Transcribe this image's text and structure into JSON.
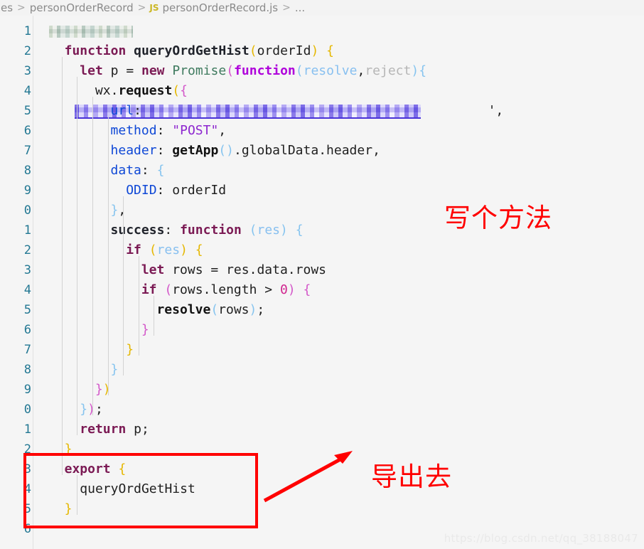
{
  "breadcrumb": {
    "items": [
      {
        "label": "es",
        "icon": null
      },
      {
        "label": "personOrderRecord",
        "icon": null
      },
      {
        "label": "personOrderRecord.js",
        "icon": "js-file-icon",
        "badge": "JS"
      },
      {
        "label": "...",
        "icon": null
      }
    ],
    "separator": ">",
    "js_badge": "JS",
    "ellipsis": "..."
  },
  "editor": {
    "language": "javascript",
    "theme": "light",
    "line_numbers": [
      "1",
      "2",
      "3",
      "4",
      "5",
      "6",
      "7",
      "8",
      "9",
      "0",
      "1",
      "2",
      "3",
      "4",
      "5",
      "6",
      "7",
      "8",
      "9",
      "0",
      "1",
      "2",
      "3",
      "4",
      "5",
      "6"
    ],
    "lines": [
      {
        "n": "1",
        "tokens": [
          {
            "t": "redacted-comment",
            "v": ""
          }
        ]
      },
      {
        "n": "2",
        "tokens": [
          {
            "t": "kw",
            "v": "function"
          },
          {
            "t": "sp",
            "v": " "
          },
          {
            "t": "fname",
            "v": "queryOrdGetHist"
          },
          {
            "t": "b-y",
            "v": "("
          },
          {
            "t": "propd",
            "v": "orderId"
          },
          {
            "t": "b-y",
            "v": ")"
          },
          {
            "t": "sp",
            "v": " "
          },
          {
            "t": "b-y",
            "v": "{"
          }
        ]
      },
      {
        "n": "3",
        "tokens": [
          {
            "t": "kw",
            "v": "let"
          },
          {
            "t": "sp",
            "v": " "
          },
          {
            "t": "propd",
            "v": "p"
          },
          {
            "t": "sp",
            "v": " "
          },
          {
            "t": "punct",
            "v": "="
          },
          {
            "t": "sp",
            "v": " "
          },
          {
            "t": "kw",
            "v": "new"
          },
          {
            "t": "sp",
            "v": " "
          },
          {
            "t": "cls",
            "v": "Promise"
          },
          {
            "t": "b-m",
            "v": "("
          },
          {
            "t": "kwfn",
            "v": "function"
          },
          {
            "t": "b-b",
            "v": "("
          },
          {
            "t": "param",
            "v": "resolve"
          },
          {
            "t": "punct",
            "v": ","
          },
          {
            "t": "unused",
            "v": "reject"
          },
          {
            "t": "b-b",
            "v": ")"
          },
          {
            "t": "b-b",
            "v": "{"
          }
        ]
      },
      {
        "n": "4",
        "tokens": [
          {
            "t": "propd",
            "v": "wx"
          },
          {
            "t": "punct",
            "v": "."
          },
          {
            "t": "call",
            "v": "request"
          },
          {
            "t": "b-y",
            "v": "("
          },
          {
            "t": "b-m",
            "v": "{"
          }
        ]
      },
      {
        "n": "5",
        "tokens": [
          {
            "t": "prop",
            "v": "url"
          },
          {
            "t": "punct",
            "v": ":"
          },
          {
            "t": "redacted-url",
            "v": ""
          },
          {
            "t": "punct",
            "v": "',"
          }
        ]
      },
      {
        "n": "6",
        "tokens": [
          {
            "t": "prop",
            "v": "method"
          },
          {
            "t": "punct",
            "v": ":"
          },
          {
            "t": "sp",
            "v": " "
          },
          {
            "t": "str",
            "v": "\"POST\""
          },
          {
            "t": "punct",
            "v": ","
          }
        ]
      },
      {
        "n": "7",
        "tokens": [
          {
            "t": "prop",
            "v": "header"
          },
          {
            "t": "punct",
            "v": ":"
          },
          {
            "t": "sp",
            "v": " "
          },
          {
            "t": "call",
            "v": "getApp"
          },
          {
            "t": "b-b",
            "v": "()"
          },
          {
            "t": "punct",
            "v": "."
          },
          {
            "t": "propd",
            "v": "globalData"
          },
          {
            "t": "punct",
            "v": "."
          },
          {
            "t": "propd",
            "v": "header"
          },
          {
            "t": "punct",
            "v": ","
          }
        ]
      },
      {
        "n": "8",
        "tokens": [
          {
            "t": "prop",
            "v": "data"
          },
          {
            "t": "punct",
            "v": ":"
          },
          {
            "t": "sp",
            "v": " "
          },
          {
            "t": "b-b",
            "v": "{"
          }
        ]
      },
      {
        "n": "9",
        "tokens": [
          {
            "t": "prop",
            "v": "ODID"
          },
          {
            "t": "punct",
            "v": ":"
          },
          {
            "t": "sp",
            "v": " "
          },
          {
            "t": "propd",
            "v": "orderId"
          }
        ]
      },
      {
        "n": "0",
        "tokens": [
          {
            "t": "b-b",
            "v": "}"
          },
          {
            "t": "punct",
            "v": ","
          }
        ]
      },
      {
        "n": "1",
        "tokens": [
          {
            "t": "fname",
            "v": "success"
          },
          {
            "t": "punct",
            "v": ":"
          },
          {
            "t": "sp",
            "v": " "
          },
          {
            "t": "kw",
            "v": "function"
          },
          {
            "t": "sp",
            "v": " "
          },
          {
            "t": "b-b",
            "v": "("
          },
          {
            "t": "param",
            "v": "res"
          },
          {
            "t": "b-b",
            "v": ")"
          },
          {
            "t": "sp",
            "v": " "
          },
          {
            "t": "b-b",
            "v": "{"
          }
        ]
      },
      {
        "n": "2",
        "tokens": [
          {
            "t": "kw",
            "v": "if"
          },
          {
            "t": "sp",
            "v": " "
          },
          {
            "t": "b-y",
            "v": "("
          },
          {
            "t": "param",
            "v": "res"
          },
          {
            "t": "b-y",
            "v": ")"
          },
          {
            "t": "sp",
            "v": " "
          },
          {
            "t": "b-y",
            "v": "{"
          }
        ]
      },
      {
        "n": "3",
        "tokens": [
          {
            "t": "kw",
            "v": "let"
          },
          {
            "t": "sp",
            "v": " "
          },
          {
            "t": "propd",
            "v": "rows"
          },
          {
            "t": "sp",
            "v": " "
          },
          {
            "t": "punct",
            "v": "="
          },
          {
            "t": "sp",
            "v": " "
          },
          {
            "t": "propd",
            "v": "res"
          },
          {
            "t": "punct",
            "v": "."
          },
          {
            "t": "propd",
            "v": "data"
          },
          {
            "t": "punct",
            "v": "."
          },
          {
            "t": "propd",
            "v": "rows"
          }
        ]
      },
      {
        "n": "4",
        "tokens": [
          {
            "t": "kw",
            "v": "if"
          },
          {
            "t": "sp",
            "v": " "
          },
          {
            "t": "b-m",
            "v": "("
          },
          {
            "t": "propd",
            "v": "rows"
          },
          {
            "t": "punct",
            "v": "."
          },
          {
            "t": "propd",
            "v": "length"
          },
          {
            "t": "sp",
            "v": " "
          },
          {
            "t": "punct",
            "v": ">"
          },
          {
            "t": "sp",
            "v": " "
          },
          {
            "t": "num",
            "v": "0"
          },
          {
            "t": "b-m",
            "v": ")"
          },
          {
            "t": "sp",
            "v": " "
          },
          {
            "t": "b-m",
            "v": "{"
          }
        ]
      },
      {
        "n": "5",
        "tokens": [
          {
            "t": "call",
            "v": "resolve"
          },
          {
            "t": "b-b",
            "v": "("
          },
          {
            "t": "propd",
            "v": "rows"
          },
          {
            "t": "b-b",
            "v": ")"
          },
          {
            "t": "punct",
            "v": ";"
          }
        ]
      },
      {
        "n": "6",
        "tokens": [
          {
            "t": "b-m",
            "v": "}"
          }
        ]
      },
      {
        "n": "7",
        "tokens": [
          {
            "t": "b-y",
            "v": "}"
          }
        ]
      },
      {
        "n": "8",
        "tokens": [
          {
            "t": "b-b",
            "v": "}"
          }
        ]
      },
      {
        "n": "9",
        "tokens": [
          {
            "t": "b-m",
            "v": "}"
          },
          {
            "t": "b-y",
            "v": ")"
          }
        ]
      },
      {
        "n": "0",
        "tokens": [
          {
            "t": "b-b",
            "v": "}"
          },
          {
            "t": "b-m",
            "v": ")"
          },
          {
            "t": "punct",
            "v": ";"
          }
        ]
      },
      {
        "n": "1",
        "tokens": [
          {
            "t": "kw",
            "v": "return"
          },
          {
            "t": "sp",
            "v": " "
          },
          {
            "t": "propd",
            "v": "p"
          },
          {
            "t": "punct",
            "v": ";"
          }
        ]
      },
      {
        "n": "2",
        "tokens": [
          {
            "t": "b-y",
            "v": "}"
          }
        ]
      },
      {
        "n": "3",
        "tokens": [
          {
            "t": "kw",
            "v": "export"
          },
          {
            "t": "sp",
            "v": " "
          },
          {
            "t": "b-y",
            "v": "{"
          }
        ]
      },
      {
        "n": "4",
        "tokens": [
          {
            "t": "propd",
            "v": "queryOrdGetHist"
          }
        ]
      },
      {
        "n": "5",
        "tokens": [
          {
            "t": "b-y",
            "v": "}"
          }
        ]
      },
      {
        "n": "6",
        "tokens": []
      }
    ]
  },
  "annotations": {
    "note_write_method": "写个方法",
    "note_export": "导出去",
    "highlight_color": "#ff0000",
    "arrow": {
      "from": "red-box",
      "to": "note_export"
    }
  },
  "watermark": {
    "text": "https://blog.csdn.net/qq_38188047"
  }
}
